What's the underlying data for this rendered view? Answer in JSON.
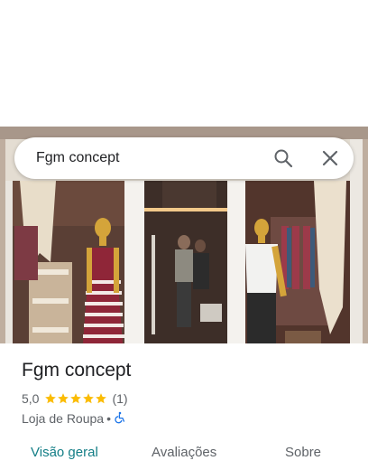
{
  "search": {
    "query": "Fgm concept"
  },
  "place": {
    "name": "Fgm concept",
    "rating_value": "5,0",
    "stars_filled": 5,
    "review_count": "(1)",
    "category": "Loja de Roupa",
    "separator": "•"
  },
  "tabs": [
    {
      "label": "Visão geral",
      "active": true
    },
    {
      "label": "Avaliações",
      "active": false
    },
    {
      "label": "Sobre",
      "active": false
    }
  ],
  "colors": {
    "accent": "#137e86",
    "star": "#fbbc04",
    "accessibility_icon": "#1a73e8"
  },
  "icons": {
    "search": "search-icon",
    "close": "close-icon",
    "accessibility": "wheelchair-icon",
    "star": "star-icon"
  }
}
